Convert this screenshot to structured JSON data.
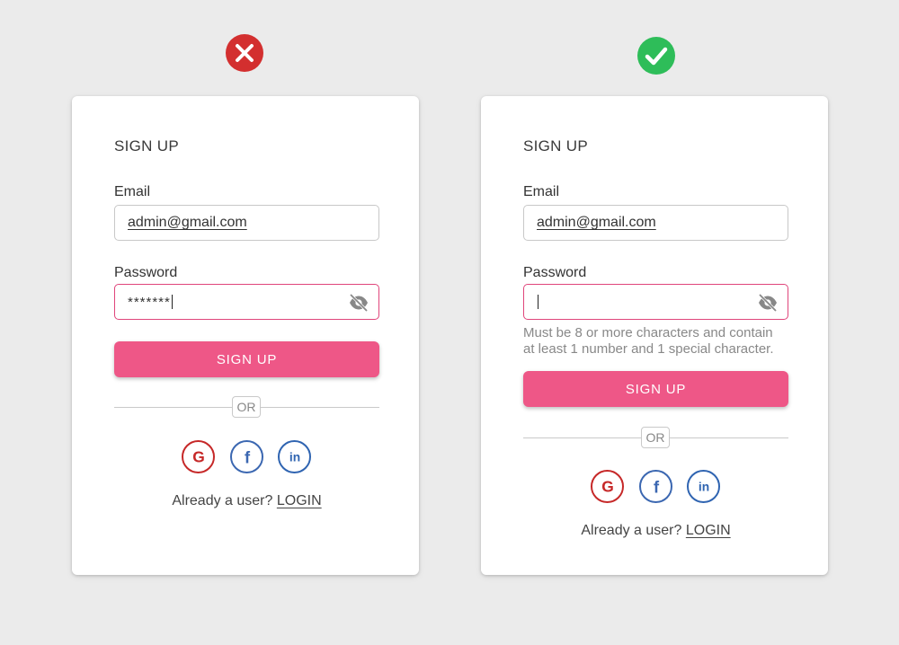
{
  "colors": {
    "bad": "#d32f2f",
    "good": "#2ebd59",
    "accent": "#ee5787",
    "error_border": "#e0457b"
  },
  "bad_example": {
    "status_icon": "cross-icon",
    "title": "SIGN UP",
    "email_label": "Email",
    "email_value": "admin@gmail.com",
    "password_label": "Password",
    "password_value": "*******",
    "submit_label": "SIGN UP",
    "or_text": "OR",
    "social": [
      "google-icon",
      "facebook-icon",
      "linkedin-icon"
    ],
    "footer_text": "Already a user?",
    "login_label": "LOGIN"
  },
  "good_example": {
    "status_icon": "check-icon",
    "title": "SIGN UP",
    "email_label": "Email",
    "email_value": "admin@gmail.com",
    "password_label": "Password",
    "password_value": "",
    "hint_line1": "Must be 8 or more characters and contain",
    "hint_line2": "at least 1 number and 1 special character.",
    "submit_label": "SIGN UP",
    "or_text": "OR",
    "social": [
      "google-icon",
      "facebook-icon",
      "linkedin-icon"
    ],
    "footer_text": "Already a user?",
    "login_label": "LOGIN"
  }
}
